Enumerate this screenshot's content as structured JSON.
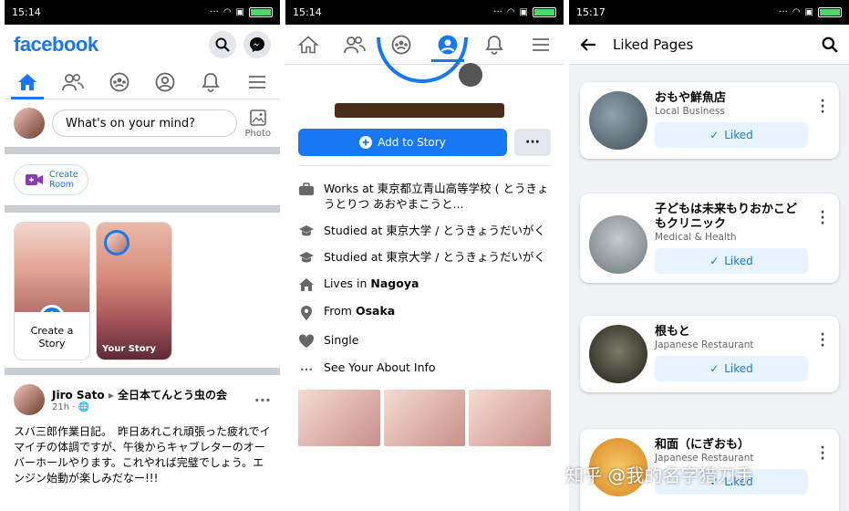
{
  "panel1": {
    "status": {
      "time": "15:14"
    },
    "logo": "facebook",
    "composer": {
      "placeholder": "What's on your mind?",
      "photo_label": "Photo"
    },
    "room": {
      "label_line1": "Create",
      "label_line2": "Room"
    },
    "stories": {
      "create_line1": "Create a",
      "create_line2": "Story",
      "your_story": "Your Story"
    },
    "post": {
      "author": "Jiro Sato",
      "group": "全日本てんとう虫の会",
      "time": "21h · ",
      "text": "スバ三郎作業日記。　昨日あれこれ頑張った疲れでイマイチの体調ですが、午後からキャブレターのオーバーホールやります。これやれば完璧でしょう。エンジン始動が楽しみだなー!!!"
    }
  },
  "panel2": {
    "status": {
      "time": "15:14"
    },
    "add_story": "Add to Story",
    "more": "···",
    "about": [
      {
        "icon": "briefcase-icon",
        "text": "Works at 東京都立青山高等学校 ( とうきょうとりつ あおやまこうと..."
      },
      {
        "icon": "graduation-cap-icon",
        "text": "Studied at 東京大学 / とうきょうだいがく"
      },
      {
        "icon": "graduation-cap-icon",
        "text": "Studied at 東京大学 / とうきょうだいがく"
      },
      {
        "icon": "home-icon",
        "prefix": "Lives in ",
        "bold": "Nagoya"
      },
      {
        "icon": "location-pin-icon",
        "prefix": "From ",
        "bold": "Osaka"
      },
      {
        "icon": "heart-icon",
        "text": "Single"
      },
      {
        "icon": "more-dots-icon",
        "text": "See Your About Info"
      }
    ]
  },
  "panel3": {
    "status": {
      "time": "15:17"
    },
    "title": "Liked Pages",
    "pages": [
      {
        "name": "おもや鮮魚店",
        "category": "Local Business",
        "button": "Liked",
        "color": "#5c6f7a"
      },
      {
        "name": "子どもは未来もりおかこどもクリニック",
        "category": "Medical & Health",
        "button": "Liked",
        "color": "#9aa3a8"
      },
      {
        "name": "根もと",
        "category": "Japanese Restaurant",
        "button": "Liked",
        "color": "#3a3a30"
      },
      {
        "name": "和面（にぎおも）",
        "category": "Japanese Restaurant",
        "button": "Liked",
        "color": "#e8a33a"
      }
    ]
  },
  "watermark": "知乎 @我的名字猎刀手",
  "colors": {
    "brand": "#1877f2",
    "liked_bg": "#e7f3ff"
  }
}
